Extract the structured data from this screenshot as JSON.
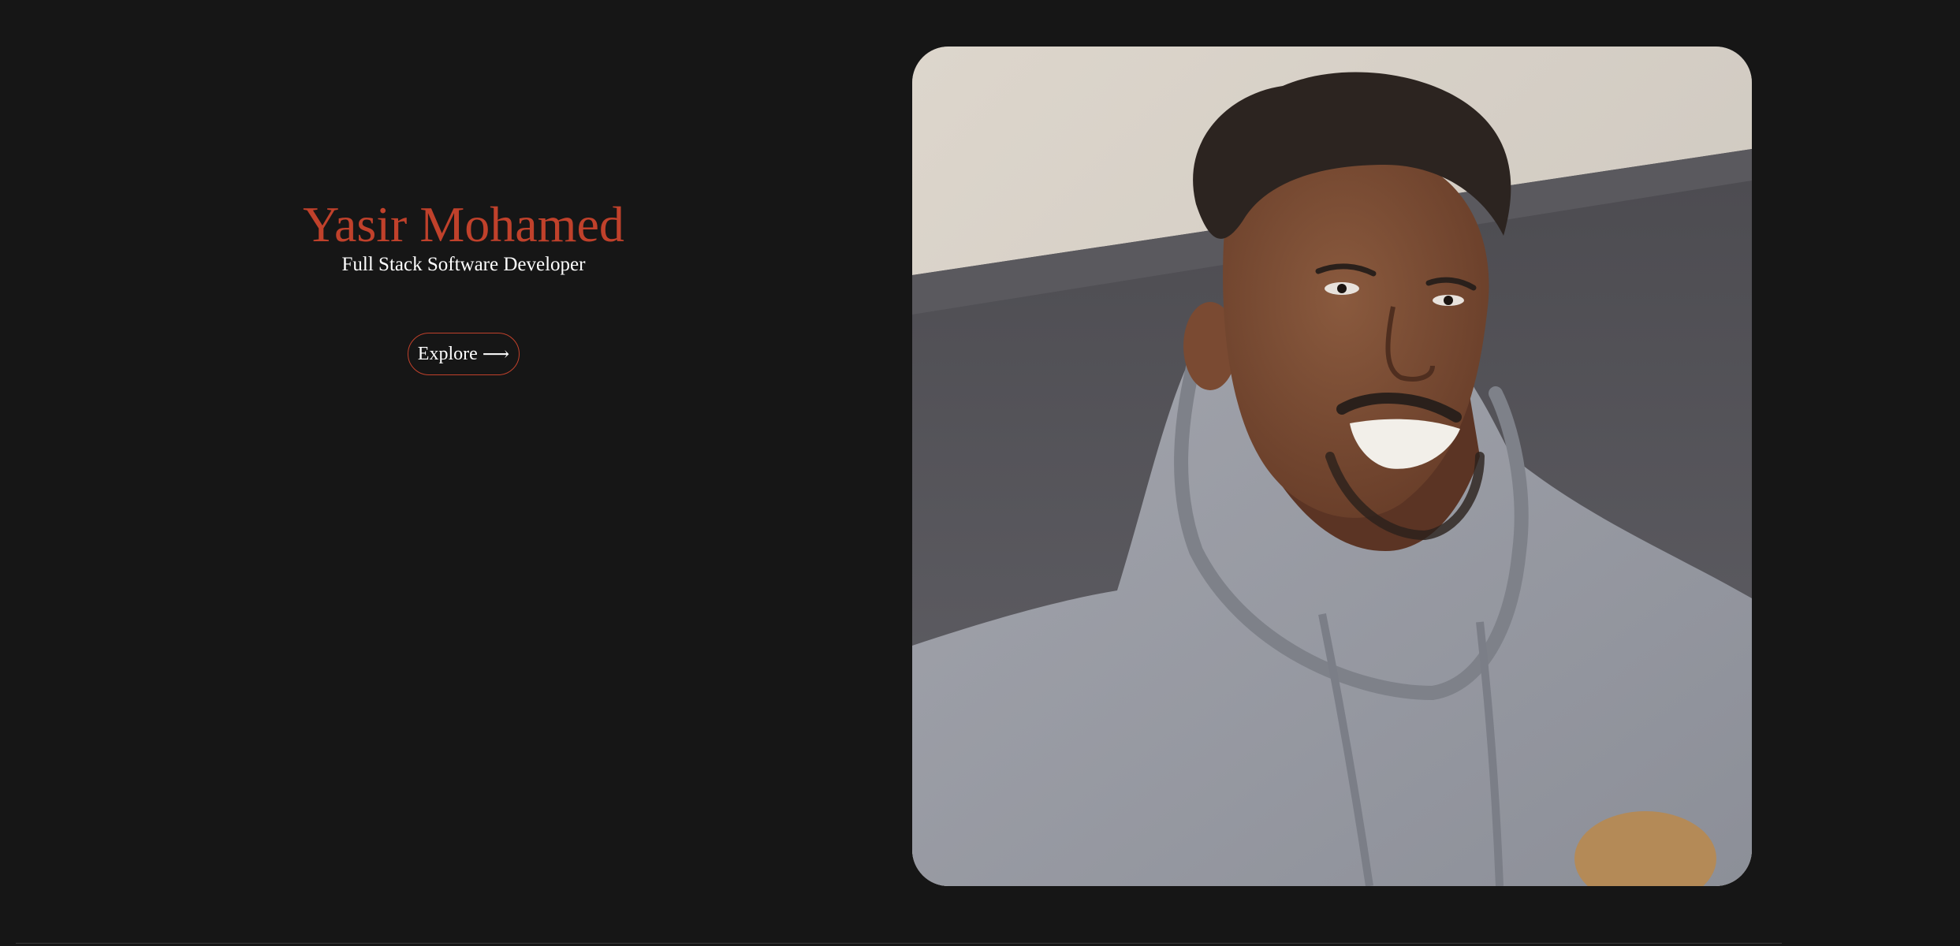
{
  "hero": {
    "name": "Yasir Mohamed",
    "role": "Full Stack Software Developer",
    "explore_label": "Explore",
    "explore_arrow": "⟶"
  },
  "portrait": {
    "icon": "profile-photo"
  },
  "colors": {
    "background": "#161616",
    "accent": "#c0412b",
    "text": "#ffffff"
  }
}
